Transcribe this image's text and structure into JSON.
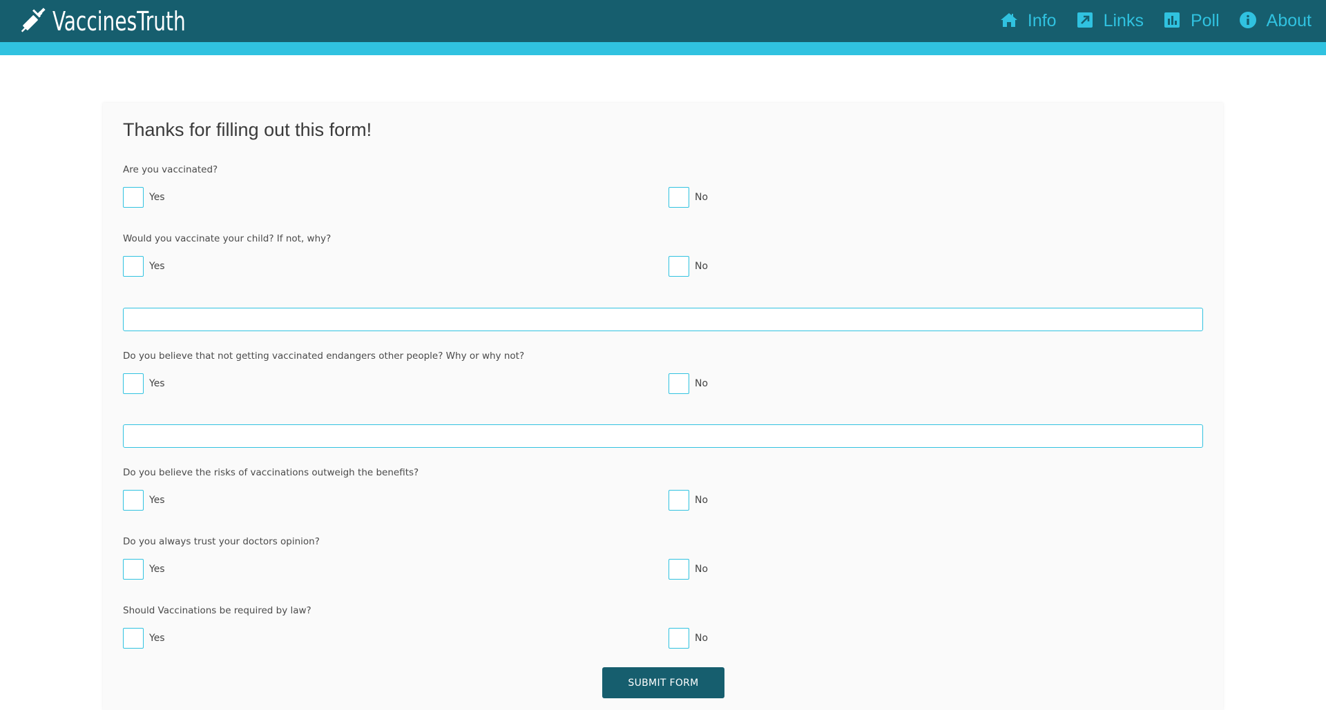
{
  "header": {
    "brand_name": "VaccinesTruth",
    "brand_icon": "syringe-icon",
    "nav": [
      {
        "label": "Info",
        "icon": "home-icon"
      },
      {
        "label": "Links",
        "icon": "external-link-icon"
      },
      {
        "label": "Poll",
        "icon": "bar-chart-icon"
      },
      {
        "label": "About",
        "icon": "info-icon"
      }
    ]
  },
  "colors": {
    "header_bg": "#165e6e",
    "accent": "#30c2e0",
    "card_bg": "#fafafa"
  },
  "form": {
    "title": "Thanks for filling out this form!",
    "questions": [
      {
        "text": "Are you vaccinated?",
        "yes": "Yes",
        "no": "No"
      },
      {
        "text": "Would you vaccinate your child? If not, why?",
        "yes": "Yes",
        "no": "No"
      },
      {
        "text": "Do you believe that not getting vaccinated endangers other people? Why or why not?",
        "yes": "Yes",
        "no": "No"
      },
      {
        "text": "Do you believe the risks of vaccinations outweigh the benefits?",
        "yes": "Yes",
        "no": "No"
      },
      {
        "text": "Do you always trust your doctors opinion?",
        "yes": "Yes",
        "no": "No"
      },
      {
        "text": "Should Vaccinations be required by law?",
        "yes": "Yes",
        "no": "No"
      }
    ],
    "reason_inputs": [
      {
        "value": "",
        "placeholder": ""
      },
      {
        "value": "",
        "placeholder": ""
      }
    ],
    "submit_label": "SUBMIT FORM"
  }
}
